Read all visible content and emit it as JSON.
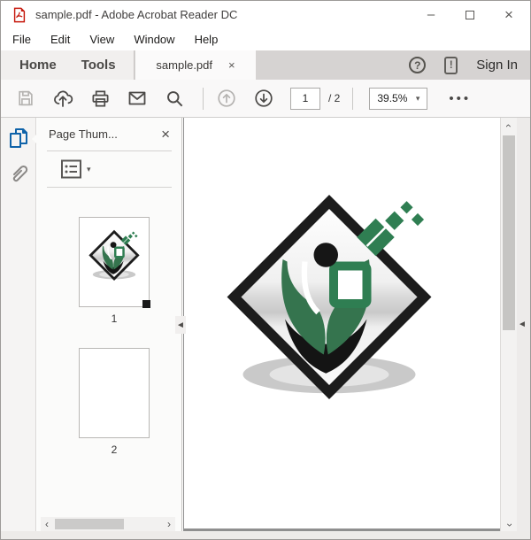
{
  "titlebar": {
    "title": "sample.pdf - Adobe Acrobat Reader DC"
  },
  "menubar": {
    "items": [
      "File",
      "Edit",
      "View",
      "Window",
      "Help"
    ]
  },
  "tabbar": {
    "home": "Home",
    "tools": "Tools",
    "doc_tab": "sample.pdf",
    "sign_in": "Sign In",
    "help_glyph": "?",
    "notification_glyph": "!"
  },
  "toolbar": {
    "page_number": "1",
    "page_total": "/ 2",
    "zoom_level": "39.5%",
    "more_dots": "•••"
  },
  "panel": {
    "title": "Page Thum...",
    "thumbnails": [
      {
        "label": "1"
      },
      {
        "label": "2"
      }
    ]
  },
  "icons": {
    "close": "×",
    "minimize": "–",
    "caret_down": "▾",
    "chevron_left": "‹",
    "chevron_right": "›",
    "collapse_left": "◄"
  },
  "colors": {
    "adobe_red": "#c6180c",
    "rail_icon_blue": "#0f63a9",
    "logo_green": "#2f7e52",
    "tab_bar_gray": "#d6d3d2",
    "toolbar_bg": "#f9f8f8",
    "pane_gray": "#8f8f8f"
  }
}
